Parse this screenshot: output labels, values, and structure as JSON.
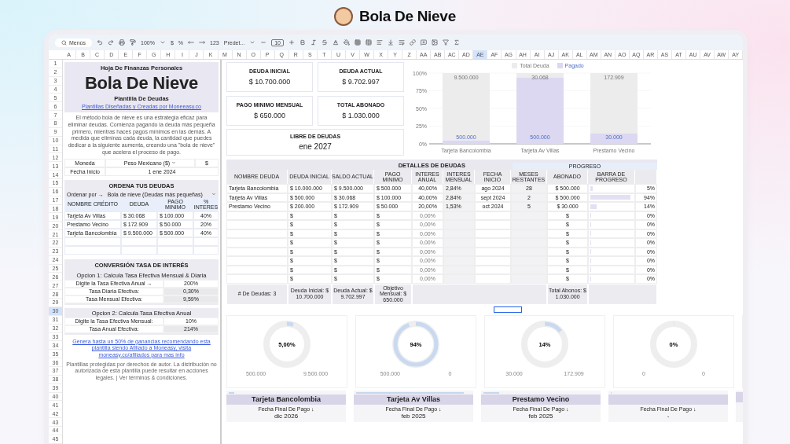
{
  "page": {
    "title": "Bola De Nieve"
  },
  "toolbar": {
    "search_placeholder": "Menús",
    "zoom": "100%",
    "currency": "$",
    "percent": "%",
    "number_format": "123",
    "font": "Predet...",
    "font_size": "10"
  },
  "column_headers": [
    {
      "label": "A",
      "selected": false
    },
    {
      "label": "B",
      "selected": false
    },
    {
      "label": "C",
      "selected": false
    },
    {
      "label": "D",
      "selected": false
    },
    {
      "label": "E",
      "selected": false
    },
    {
      "label": "F",
      "selected": false
    },
    {
      "label": "G",
      "selected": false
    },
    {
      "label": "H",
      "selected": false
    },
    {
      "label": "I",
      "selected": false
    },
    {
      "label": "J",
      "selected": false
    },
    {
      "label": "K",
      "selected": false
    },
    {
      "label": "M",
      "selected": false
    },
    {
      "label": "N",
      "selected": false
    },
    {
      "label": "O",
      "selected": false
    },
    {
      "label": "P",
      "selected": false
    },
    {
      "label": "Q",
      "selected": false
    },
    {
      "label": "R",
      "selected": false
    },
    {
      "label": "S",
      "selected": false
    },
    {
      "label": "T",
      "selected": false
    },
    {
      "label": "U",
      "selected": false
    },
    {
      "label": "V",
      "selected": false
    },
    {
      "label": "W",
      "selected": false
    },
    {
      "label": "X",
      "selected": false
    },
    {
      "label": "Y",
      "selected": false
    },
    {
      "label": "Z",
      "selected": false
    },
    {
      "label": "AA",
      "selected": false
    },
    {
      "label": "AB",
      "selected": false
    },
    {
      "label": "AC",
      "selected": false
    },
    {
      "label": "AD",
      "selected": false
    },
    {
      "label": "AE",
      "selected": true
    },
    {
      "label": "AF",
      "selected": false
    },
    {
      "label": "AG",
      "selected": false
    },
    {
      "label": "AH",
      "selected": false
    },
    {
      "label": "AI",
      "selected": false
    },
    {
      "label": "AJ",
      "selected": false
    },
    {
      "label": "AK",
      "selected": false
    },
    {
      "label": "AL",
      "selected": false
    },
    {
      "label": "AM",
      "selected": false
    },
    {
      "label": "AN",
      "selected": false
    },
    {
      "label": "AO",
      "selected": false
    },
    {
      "label": "AQ",
      "selected": false
    },
    {
      "label": "AR",
      "selected": false
    },
    {
      "label": "AS",
      "selected": false
    },
    {
      "label": "AT",
      "selected": false
    },
    {
      "label": "AU",
      "selected": false
    },
    {
      "label": "AV",
      "selected": false
    },
    {
      "label": "AW",
      "selected": false
    },
    {
      "label": "AY",
      "selected": false
    }
  ],
  "row_numbers": [
    {
      "label": "1",
      "selected": false
    },
    {
      "label": "2",
      "selected": false
    },
    {
      "label": "3",
      "selected": false
    },
    {
      "label": "4",
      "selected": false
    },
    {
      "label": "5",
      "selected": false
    },
    {
      "label": "6",
      "selected": false
    },
    {
      "label": "7",
      "selected": false
    },
    {
      "label": "8",
      "selected": false
    },
    {
      "label": "9",
      "selected": false
    },
    {
      "label": "10",
      "selected": false
    },
    {
      "label": "11",
      "selected": false
    },
    {
      "label": "12",
      "selected": false
    },
    {
      "label": "13",
      "selected": false
    },
    {
      "label": "14",
      "selected": false
    },
    {
      "label": "15",
      "selected": false
    },
    {
      "label": "16",
      "selected": false
    },
    {
      "label": "17",
      "selected": false
    },
    {
      "label": "18",
      "selected": false
    },
    {
      "label": "19",
      "selected": false
    },
    {
      "label": "20",
      "selected": false
    },
    {
      "label": "21",
      "selected": false
    },
    {
      "label": "22",
      "selected": false
    },
    {
      "label": "23",
      "selected": false
    },
    {
      "label": "24",
      "selected": false
    },
    {
      "label": "25",
      "selected": false
    },
    {
      "label": "26",
      "selected": false
    },
    {
      "label": "27",
      "selected": false
    },
    {
      "label": "28",
      "selected": false
    },
    {
      "label": "29",
      "selected": false
    },
    {
      "label": "30",
      "selected": true
    },
    {
      "label": "31",
      "selected": false
    },
    {
      "label": "32",
      "selected": false
    },
    {
      "label": "33",
      "selected": false
    },
    {
      "label": "34",
      "selected": false
    },
    {
      "label": "35",
      "selected": false
    },
    {
      "label": "36",
      "selected": false
    },
    {
      "label": "37",
      "selected": false
    },
    {
      "label": "38",
      "selected": false
    },
    {
      "label": "39",
      "selected": false
    },
    {
      "label": "40",
      "selected": false
    },
    {
      "label": "41",
      "selected": false
    },
    {
      "label": "42",
      "selected": false
    },
    {
      "label": "43",
      "selected": false
    },
    {
      "label": "44",
      "selected": false
    },
    {
      "label": "45",
      "selected": false
    }
  ],
  "header_card": {
    "kicker": "Hoja De Finanzas Personales",
    "title": "Bola De Nieve",
    "subtitle": "Plantilla De Deudas",
    "link": "Plantillas Diseñadas y Creadas por Moneeasy.co"
  },
  "description": "El método bola de nieve es una estrategia eficaz para eliminar deudas. Comienza pagando la deuda más pequeña primero, mientras haces pagos mínimos en las demás. A medida que eliminas cada deuda, la cantidad que puedes dedicar a la siguiente aumenta, creando una \"bola de nieve\" que acelera el proceso de pago.",
  "settings": {
    "currency_label": "Moneda",
    "currency_value": "Peso Mexicano ($)",
    "currency_symbol": "$",
    "start_label": "Fecha Inicio",
    "start_value": "1 ene 2024"
  },
  "order": {
    "title": "ORDENA TUS DEUDAS",
    "sort_label": "Ordenar por →",
    "sort_value": "Bola de nieve (Deudas más pequeñas)",
    "columns": [
      "NOMBRE CRÉDITO",
      "DEUDA",
      "PAGO MINIMO",
      "% INTERES"
    ],
    "rows": [
      [
        "Tarjeta Av Villas",
        "$ 30.068",
        "$ 100.000",
        "40%"
      ],
      [
        "Prestamo Vecino",
        "$ 172.909",
        "$ 50.000",
        "20%"
      ],
      [
        "Tarjeta Bancolombia",
        "$ 9.500.000",
        "$ 500.000",
        "40%"
      ]
    ]
  },
  "conversion": {
    "title": "CONVERSIÓN TASA DE INTERÉS",
    "options": [
      {
        "heading": "Opcion 1: Calcula Tasa Efectiva Mensual & Diaria",
        "rows": [
          [
            "Digite la Tasa Efectiva Anual →",
            "200%"
          ],
          [
            "Tasa Diaria Efectiva:",
            "0,30%"
          ],
          [
            "Tasa Mensual Efectiva:",
            "9,59%"
          ]
        ]
      },
      {
        "heading": "Opcion 2: Calcula Tasa Efectiva Anual",
        "rows": [
          [
            "Digite la Tasa Efectiva Mensual:",
            "10%"
          ],
          [
            "Tasa Anual Efectiva:",
            "214%"
          ]
        ]
      }
    ]
  },
  "footer_link": "Genera hasta un 50% de ganancias recomendando esta plantilla siendo Afiliado a Moneasy, visita moneasy.co/afiliados para mas info",
  "footer_note": "Plantillas protegidas por derechos de autor. La distribución no autorizada de esta plantilla puede resultar en acciones legales. | Ver términos & condiciones.",
  "kpis": [
    {
      "label": "DEUDA INICIAL",
      "value": "$ 10.700.000"
    },
    {
      "label": "DEUDA ACTUAL",
      "value": "$ 9.702.997"
    },
    {
      "label": "PAGO MINIMO MENSUAL",
      "value": "$ 650.000"
    },
    {
      "label": "TOTAL ABONADO",
      "value": "$ 1.030.000"
    }
  ],
  "debt_free": {
    "label": "LIBRE DE DEUDAS",
    "value": "ene 2027"
  },
  "chart": {
    "chart_data": {
      "type": "bar",
      "stacked": true,
      "categories": [
        "Tarjeta Bancolombia",
        "Tarjeta Av Villas",
        "Prestamo Vecino"
      ],
      "series": [
        {
          "name": "Pagado",
          "color": "#dcd8f2",
          "values": [
            0.05,
            0.94,
            0.15
          ]
        },
        {
          "name": "Total Deuda",
          "color": "#ececec",
          "values": [
            0.95,
            0.06,
            0.85
          ]
        }
      ],
      "ylim": [
        0,
        1
      ],
      "yticks": [
        {
          "value": 0,
          "label": "0%"
        },
        {
          "value": 0.25,
          "label": "25%"
        },
        {
          "value": 0.5,
          "label": "50%"
        },
        {
          "value": 0.75,
          "label": "75%"
        },
        {
          "value": 1,
          "label": "100%"
        }
      ],
      "value_labels": [
        [
          "500.000",
          "500.000",
          "30.000"
        ],
        [
          "9.500.000",
          "30.068",
          "172.909"
        ]
      ],
      "legend": "top"
    }
  },
  "details": {
    "title": "DETALLES DE DEUDAS",
    "progress_title": "PROGRESO",
    "columns": [
      "NOMBRE DEUDA",
      "DEUDA INICIAL",
      "SALDO ACTUAL",
      "PAGO MINIMO",
      "INTERES ANUAL",
      "INTERES MENSUAL",
      "FECHA INICIO",
      "MESES RESTANTES",
      "ABONADO",
      "BARRA DE PROGRESO"
    ],
    "rows": [
      {
        "name": "Tarjeta Bancolombia",
        "initial": "$ 10.000.000",
        "balance": "$ 9.500.000",
        "minimum": "$ 500.000",
        "annual": "40,00%",
        "monthly": "2,84%",
        "start": "ago 2024",
        "months": "28",
        "paid": "$ 500.000",
        "level": 0.05,
        "percent": "5%"
      },
      {
        "name": "Tarjeta Av Villas",
        "initial": "$ 500.000",
        "balance": "$ 30.068",
        "minimum": "$ 100.000",
        "annual": "40,00%",
        "monthly": "2,84%",
        "start": "sept 2024",
        "months": "2",
        "paid": "$ 500.000",
        "level": 0.94,
        "percent": "94%"
      },
      {
        "name": "Prestamo Vecino",
        "initial": "$ 200.000",
        "balance": "$ 172.909",
        "minimum": "$ 50.000",
        "annual": "20,00%",
        "monthly": "1,53%",
        "start": "oct 2024",
        "months": "5",
        "paid": "$ 30.000",
        "level": 0.14,
        "percent": "14%"
      },
      {
        "initial": "$",
        "balance": "$",
        "minimum": "$",
        "annual": "0,00%",
        "paid": "$",
        "level": 0,
        "percent": "0%"
      },
      {
        "initial": "$",
        "balance": "$",
        "minimum": "$",
        "annual": "0,00%",
        "paid": "$",
        "level": 0,
        "percent": "0%"
      },
      {
        "initial": "$",
        "balance": "$",
        "minimum": "$",
        "annual": "0,00%",
        "paid": "$",
        "level": 0,
        "percent": "0%"
      },
      {
        "initial": "$",
        "balance": "$",
        "minimum": "$",
        "annual": "0,00%",
        "paid": "$",
        "level": 0,
        "percent": "0%"
      },
      {
        "initial": "$",
        "balance": "$",
        "minimum": "$",
        "annual": "0,00%",
        "paid": "$",
        "level": 0,
        "percent": "0%"
      },
      {
        "initial": "$",
        "balance": "$",
        "minimum": "$",
        "annual": "0,00%",
        "paid": "$",
        "level": 0,
        "percent": "0%"
      },
      {
        "initial": "$",
        "balance": "$",
        "minimum": "$",
        "annual": "0,00%",
        "paid": "$",
        "level": 0,
        "percent": "0%"
      },
      {
        "initial": "$",
        "balance": "$",
        "minimum": "$",
        "annual": "0,00%",
        "paid": "$",
        "level": 0,
        "percent": "0%"
      }
    ],
    "totals": {
      "count": "# De Deudas: 3",
      "initial": "Deuda Inicial: $ 10.700.000",
      "balance": "Deuda Actual: $ 9.702.997",
      "goal": "Objetivo Mensual: $ 650.000",
      "paid": "Total Abonos: $ 1.030.000"
    }
  },
  "donuts": [
    {
      "value": "5,00%",
      "level": 0.05,
      "paid": "500.000",
      "remaining": "9.500.000"
    },
    {
      "value": "94%",
      "level": 0.94,
      "paid": "500.000",
      "remaining": "0"
    },
    {
      "value": "14%",
      "level": 0.14,
      "paid": "30.000",
      "remaining": "172.909"
    },
    {
      "value": "0%",
      "level": 0,
      "paid": "0",
      "remaining": "0"
    }
  ],
  "payoff_cards": [
    {
      "name": "Tarjeta Bancolombia",
      "label": "Fecha Final De Pago ↓",
      "date": "dic 2026",
      "level": 0.05
    },
    {
      "name": "Tarjeta Av Villas",
      "label": "Fecha Final De Pago ↓",
      "date": "feb 2025",
      "level": 0.94
    },
    {
      "name": "Prestamo Vecino",
      "label": "Fecha Final De Pago ↓",
      "date": "feb 2025",
      "level": 0.14
    },
    {
      "label": "Fecha Final De Pago ↓",
      "date": "-",
      "level": 0
    }
  ]
}
